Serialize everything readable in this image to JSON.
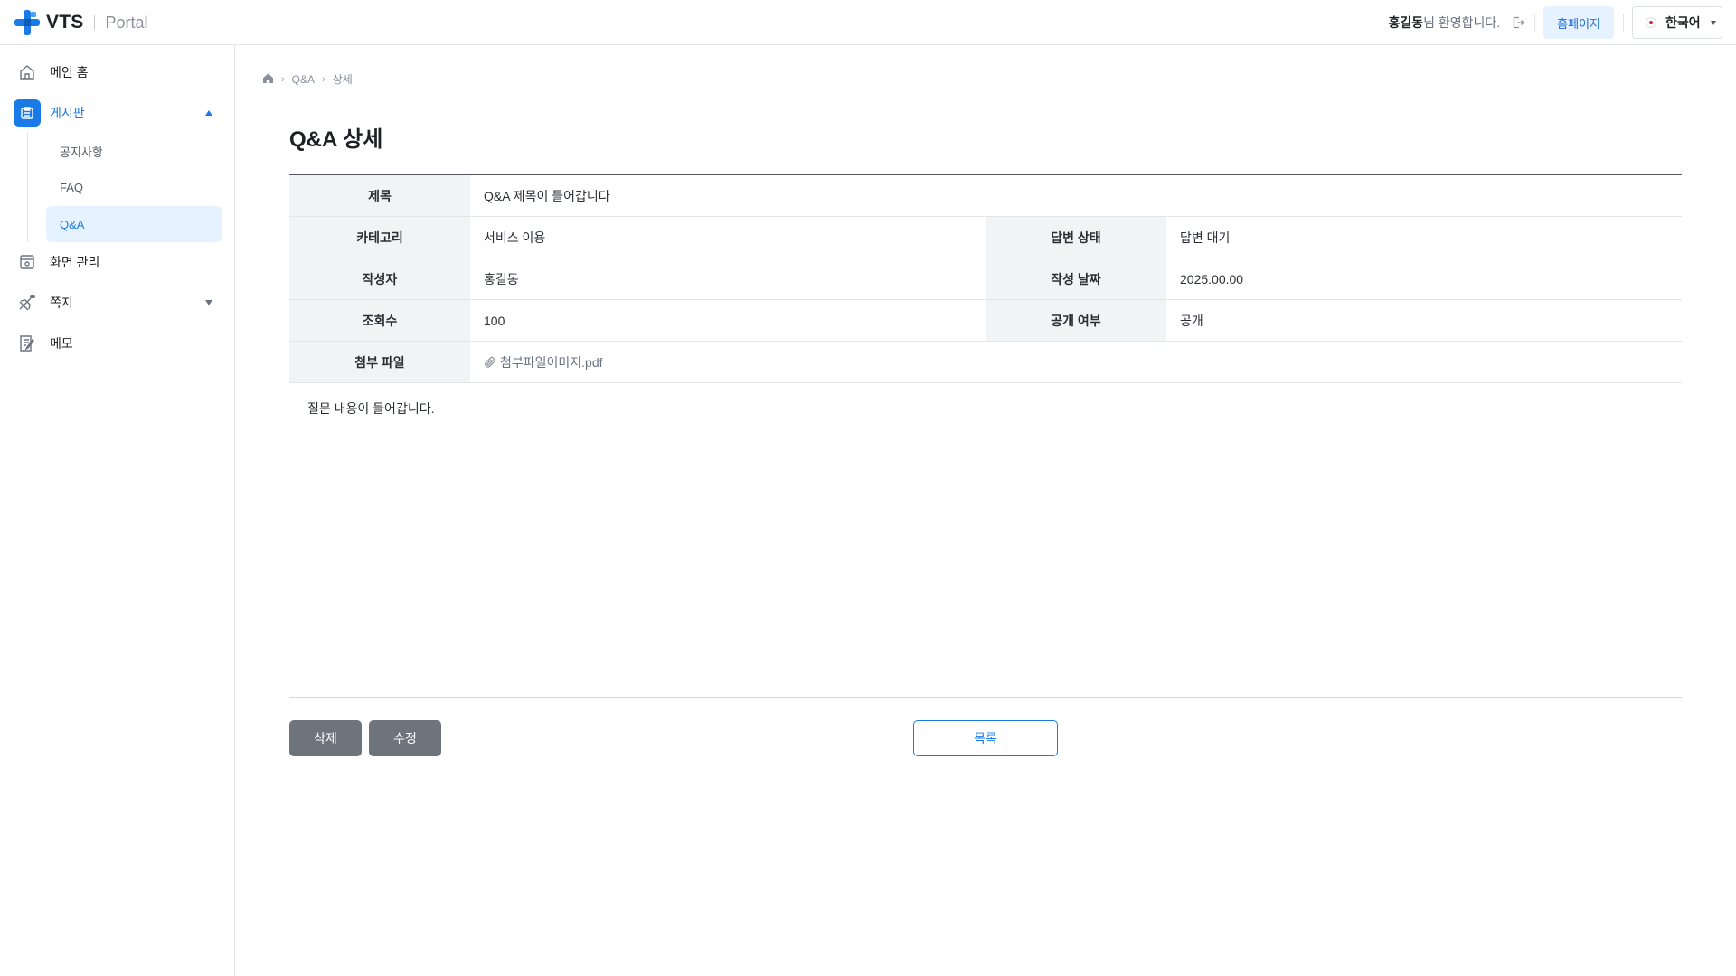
{
  "header": {
    "logo_text": "VTS",
    "logo_sub": "Portal",
    "user_name": "홍길동",
    "welcome_suffix": "님 환영합니다.",
    "homepage_label": "홈페이지",
    "language_label": "한국어"
  },
  "sidebar": {
    "items": [
      {
        "label": "메인 홈",
        "icon": "home-icon"
      },
      {
        "label": "게시판",
        "icon": "board-icon",
        "active": true,
        "expanded": true
      },
      {
        "label": "화면 관리",
        "icon": "screen-manage-icon"
      },
      {
        "label": "쪽지",
        "icon": "message-icon",
        "expanded": false
      },
      {
        "label": "메모",
        "icon": "memo-icon"
      }
    ],
    "board_sub": [
      {
        "label": "공지사항"
      },
      {
        "label": "FAQ"
      },
      {
        "label": "Q&A",
        "active": true
      }
    ]
  },
  "breadcrumb": {
    "items": [
      "Q&A",
      "상세"
    ]
  },
  "page": {
    "title": "Q&A 상세"
  },
  "detail": {
    "title_label": "제목",
    "title_value": "Q&A 제목이 들어갑니다",
    "category_label": "카테고리",
    "category_value": "서비스 이용",
    "answer_status_label": "답변 상태",
    "answer_status_value": "답변 대기",
    "author_label": "작성자",
    "author_value": "홍길동",
    "date_label": "작성 날짜",
    "date_value": "2025.00.00",
    "views_label": "조회수",
    "views_value": "100",
    "public_label": "공개 여부",
    "public_value": "공개",
    "attach_label": "첨부 파일",
    "attach_value": "첨부파일이미지.pdf"
  },
  "content": {
    "body": "질문 내용이 들어갑니다."
  },
  "actions": {
    "delete_label": "삭제",
    "edit_label": "수정",
    "list_label": "목록"
  },
  "colors": {
    "accent": "#1a7be8",
    "accent_bg": "#e6f2ff",
    "gray_button": "#6e747c",
    "table_header_bg": "#f2f3f5"
  }
}
